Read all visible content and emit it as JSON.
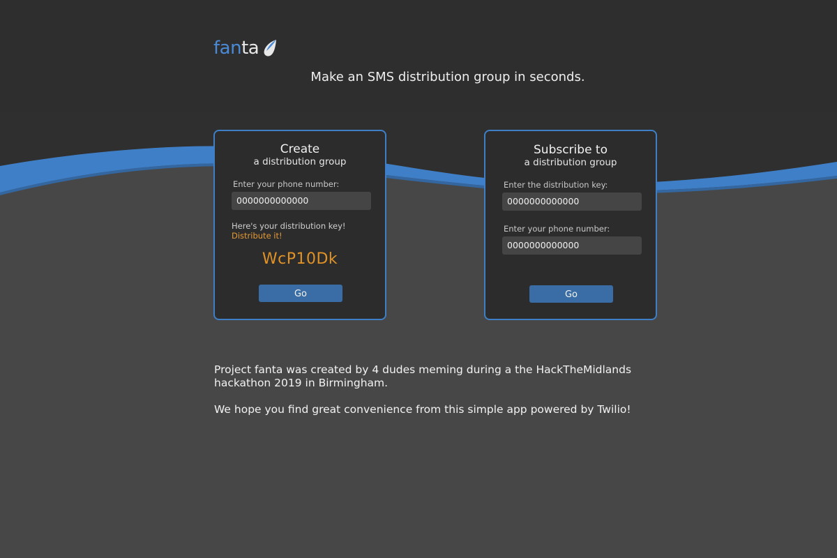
{
  "logo": {
    "part1": "fan",
    "part2": "ta",
    "icon": "sail-drop-icon"
  },
  "tagline": "Make an SMS distribution group in seconds.",
  "create_card": {
    "title": "Create",
    "subtitle": "a distribution group",
    "phone_label": "Enter your phone number:",
    "phone_value": "0000000000000",
    "key_note": "Here's your distribution key!",
    "distribute_label": "Distribute it!",
    "key_value": "WcP10Dk",
    "go_label": "Go"
  },
  "subscribe_card": {
    "title": "Subscribe to",
    "subtitle": "a distribution group",
    "key_label": "Enter the distribution key:",
    "key_value": "0000000000000",
    "phone_label": "Enter your phone number:",
    "phone_value": "0000000000000",
    "go_label": "Go"
  },
  "about": {
    "para1": "Project fanta was created by 4 dudes meming during a the HackTheMidlands hackathon 2019 in Birmingham.",
    "para2": "We hope you find great convenience from this simple app powered by Twilio!"
  },
  "colors": {
    "accent": "#3f7fc8",
    "background": "#474747",
    "card_bg": "#2c2c2c",
    "key_orange": "#e09226",
    "button": "#3a6da6"
  }
}
